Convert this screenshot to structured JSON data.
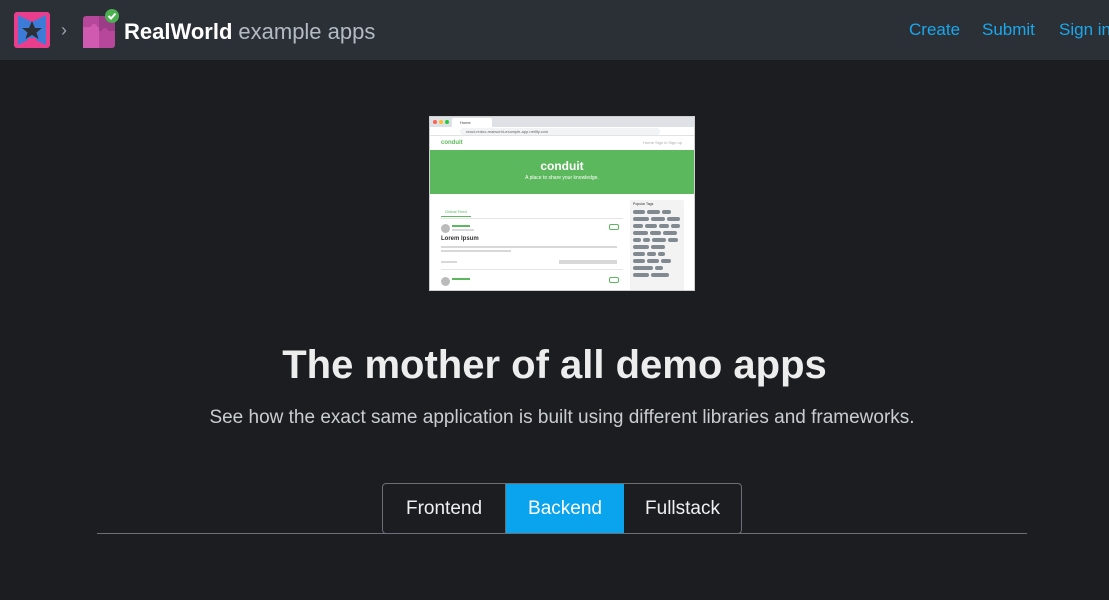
{
  "header": {
    "brand_strong": "RealWorld",
    "brand_light": "example apps",
    "breadcrumb_separator": "›",
    "nav": [
      "Create",
      "Submit",
      "Sign in"
    ]
  },
  "preview": {
    "tab_title": "Home",
    "url": "react-redux-realworld-example-app.netlify.com",
    "app_name": "conduit",
    "nav_links": "Home   Sign in   Sign up",
    "banner_title": "conduit",
    "banner_subtitle": "A place to share your knowledge.",
    "feed_tab": "Global Feed",
    "article_title": "Lorem Ipsum",
    "sidebar_heading": "Popular Tags"
  },
  "hero": {
    "title": "The mother of all demo apps",
    "subtitle": "See how the exact same application is built using different libraries and frameworks."
  },
  "tabs": {
    "items": [
      "Frontend",
      "Backend",
      "Fullstack"
    ],
    "active": "Backend"
  },
  "colors": {
    "background": "#1b1d21",
    "header": "#2b3037",
    "accent": "#0aa3ed",
    "link": "#1aa7ec",
    "conduit_green": "#5cb85c"
  }
}
